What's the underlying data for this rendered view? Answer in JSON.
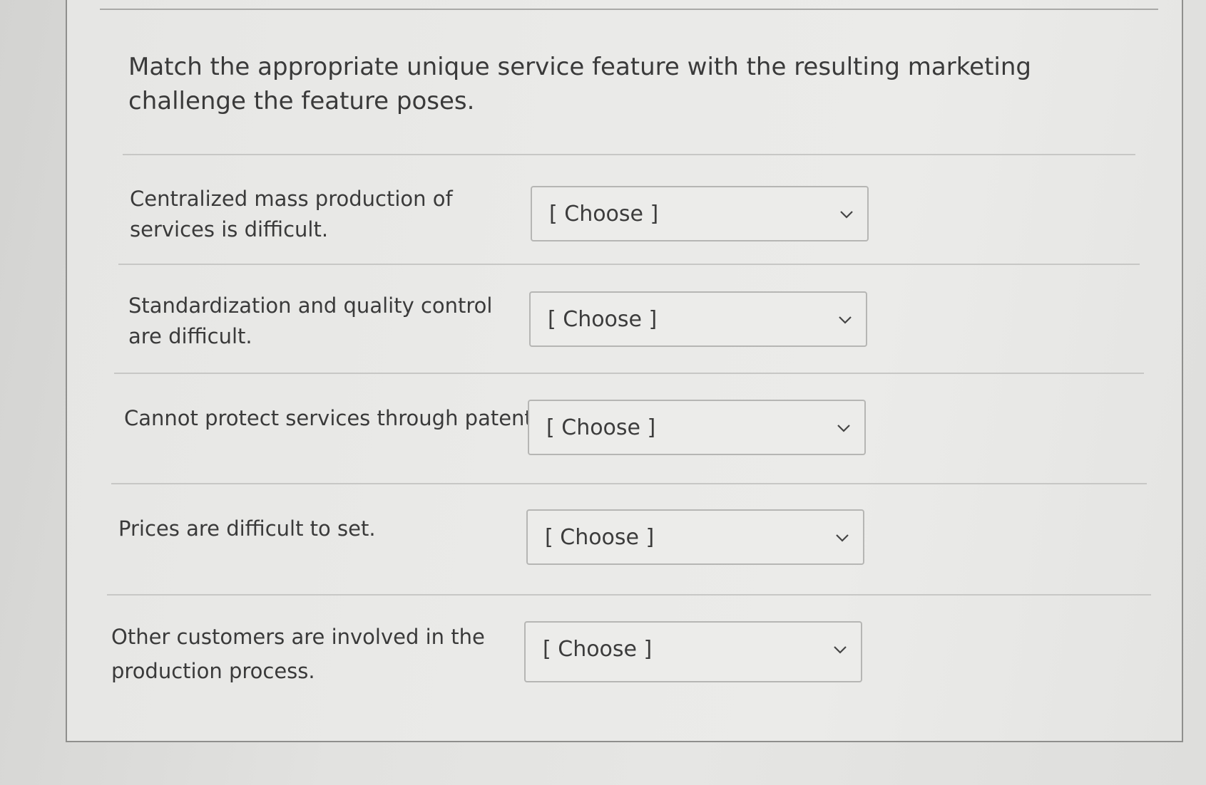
{
  "question": {
    "prompt": "Match the appropriate unique service feature with the resulting marketing challenge the feature poses."
  },
  "rows": [
    {
      "label": "Centralized mass production of services is difficult.",
      "selected": "[ Choose ]"
    },
    {
      "label": "Standardization and quality control are difficult.",
      "selected": "[ Choose ]"
    },
    {
      "label": "Cannot protect services through patents.",
      "selected": "[ Choose ]"
    },
    {
      "label": "Prices are difficult to set.",
      "selected": "[ Choose ]"
    },
    {
      "label": "Other customers are involved in the production process.",
      "selected": "[ Choose ]"
    }
  ],
  "icons": {
    "dropdown": "chevron-down-icon"
  },
  "colors": {
    "text": "#3a3a3a",
    "border": "#b6b6b4",
    "background": "#e8e8e6"
  }
}
